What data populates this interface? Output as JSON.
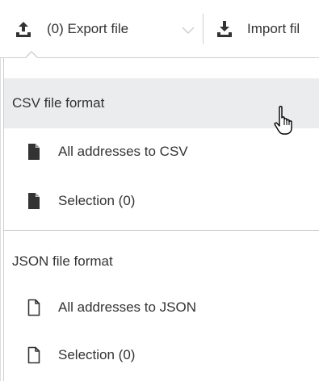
{
  "toolbar": {
    "export_label": "(0) Export file",
    "import_label": "Import fil",
    "icons": {
      "export": "upload-icon",
      "caret": "chevron-down-icon",
      "import": "download-icon"
    }
  },
  "dropdown": {
    "csv": {
      "header": "CSV file format",
      "items": [
        {
          "label": "All addresses to CSV",
          "icon": "file-solid-icon"
        },
        {
          "label": "Selection (0)",
          "icon": "file-solid-icon"
        }
      ]
    },
    "json": {
      "header": "JSON file format",
      "items": [
        {
          "label": "All addresses to JSON",
          "icon": "file-outline-icon"
        },
        {
          "label": "Selection (0)",
          "icon": "file-outline-icon"
        }
      ]
    }
  },
  "colors": {
    "hover_background": "#ebeced",
    "text": "#333333",
    "border": "#cfcfcf"
  },
  "cursor": "hand-pointer-icon"
}
